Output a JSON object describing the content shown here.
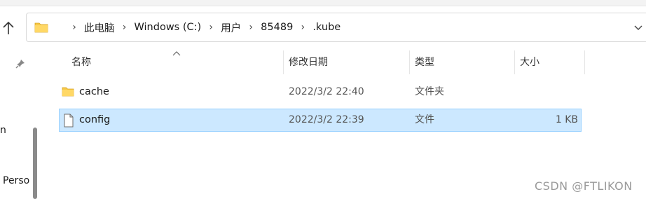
{
  "address_bar": {
    "crumbs": [
      "此电脑",
      "Windows (C:)",
      "用户",
      "85489",
      ".kube"
    ],
    "separator": "›"
  },
  "navigation_pane": {
    "items": [
      "n",
      "Perso"
    ]
  },
  "columns": {
    "name": "名称",
    "date_modified": "修改日期",
    "type": "类型",
    "size": "大小"
  },
  "files": [
    {
      "name": "cache",
      "date_modified": "2022/3/2 22:40",
      "type": "文件夹",
      "size": "",
      "icon": "folder-icon",
      "selected": false
    },
    {
      "name": "config",
      "date_modified": "2022/3/2 22:39",
      "type": "文件",
      "size": "1 KB",
      "icon": "file-icon",
      "selected": true
    }
  ],
  "watermark": "CSDN @FTLIKON",
  "colors": {
    "selection_bg": "#cce8ff",
    "selection_border": "#99d1ff",
    "folder": "#f7c948"
  }
}
